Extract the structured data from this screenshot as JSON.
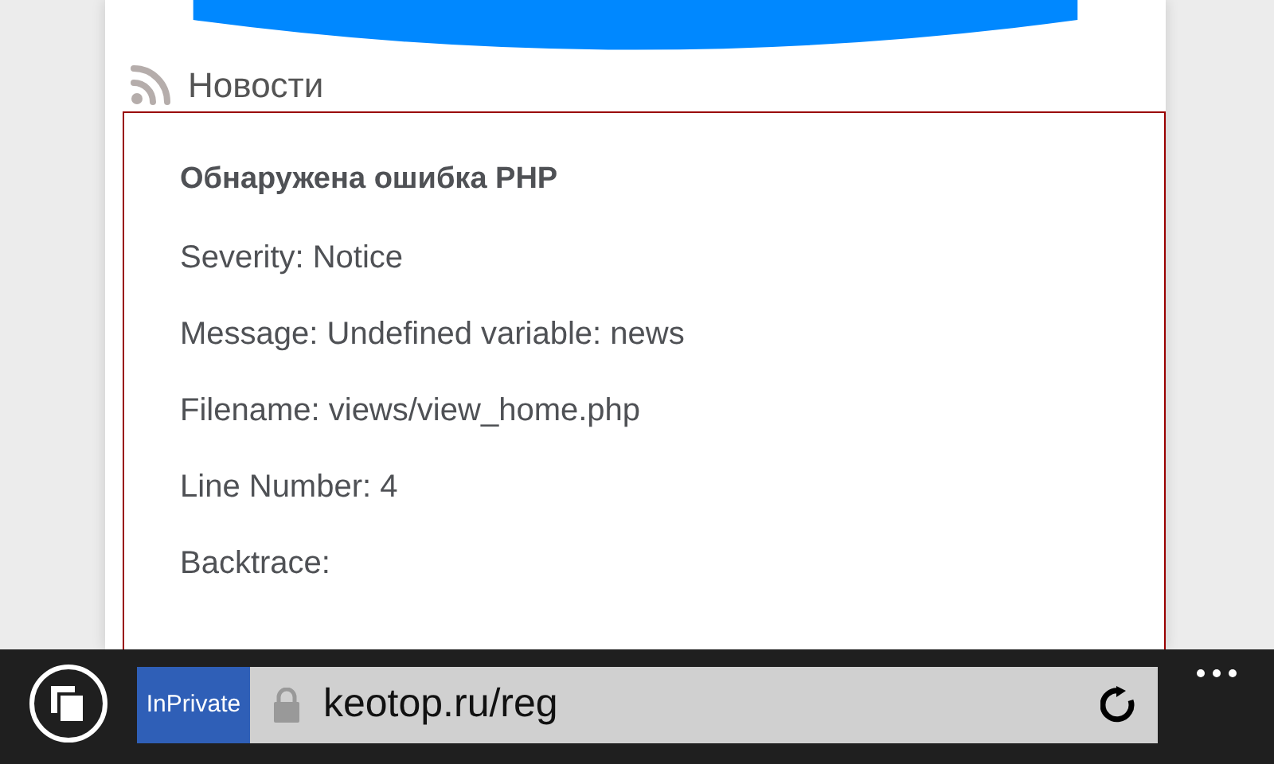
{
  "section": {
    "title": "Новости"
  },
  "error": {
    "title": "Обнаружена ошибка PHP",
    "lines": [
      "Severity: Notice",
      "Message: Undefined variable: news",
      "Filename: views/view_home.php",
      "Line Number: 4",
      "Backtrace:"
    ]
  },
  "browser": {
    "badge": "InPrivate",
    "url": "keotop.ru/reg"
  }
}
